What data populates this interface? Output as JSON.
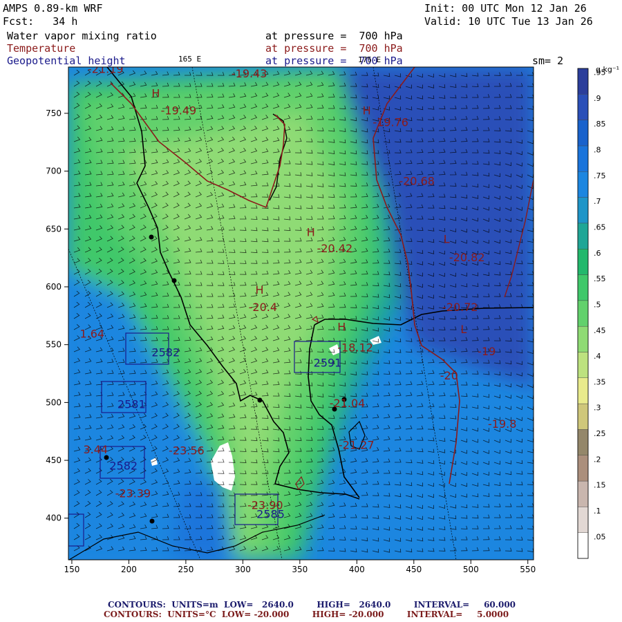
{
  "header": {
    "model": "AMPS 0.89-km WRF",
    "forecast": "Fcst:   34 h",
    "init": "Init: 00 UTC Mon 12 Jan 26",
    "valid": "Valid: 10 UTC Tue 13 Jan 26",
    "field1_name": "Water vapor mixing ratio",
    "field1_level": "at pressure =  700 hPa",
    "field2_name": "Temperature",
    "field2_level": "at pressure =  700 hPa",
    "field3_name": "Geopotential height",
    "field3_level": "at pressure =  700 hPa",
    "smoothing": "sm= 2",
    "lon_label_left": "165 E",
    "lon_label_right": "175 E"
  },
  "colorbar": {
    "unit": "g kg⁻¹",
    "levels": [
      ".05",
      ".1",
      ".15",
      ".2",
      ".25",
      ".3",
      ".35",
      ".4",
      ".45",
      ".5",
      ".55",
      ".6",
      ".65",
      ".7",
      ".75",
      ".8",
      ".85",
      ".9",
      ".95"
    ],
    "colors": [
      "#ffffff",
      "#e2d8d4",
      "#c9b6ae",
      "#ab8f7c",
      "#94876a",
      "#cfc77a",
      "#e9eb8c",
      "#bde27f",
      "#8fdb74",
      "#62d16c",
      "#3fc86a",
      "#22b86c",
      "#1fa696",
      "#1e95c8",
      "#1c86e0",
      "#1a74db",
      "#1962cc",
      "#2a4fb8",
      "#2b3e9b"
    ]
  },
  "chart_data": {
    "type": "heatmap",
    "title": "Water vapor mixing ratio at pressure = 700 hPa",
    "x_ticks": [
      "150",
      "200",
      "250",
      "300",
      "350",
      "400",
      "450",
      "500",
      "550"
    ],
    "y_ticks": [
      "400",
      "450",
      "500",
      "550",
      "600",
      "650",
      "700",
      "750"
    ],
    "xlim": [
      147,
      555
    ],
    "ylim": [
      364,
      790
    ],
    "temperature_labels": [
      {
        "text": "H",
        "x": 220,
        "y": 764
      },
      {
        "text": "-19.49",
        "x": 228,
        "y": 749
      },
      {
        "text": "-19.43",
        "x": 290,
        "y": 781
      },
      {
        "text": "H",
        "x": 405,
        "y": 749
      },
      {
        "text": "-19.76",
        "x": 414,
        "y": 739
      },
      {
        "text": "-20.68",
        "x": 437,
        "y": 688
      },
      {
        "text": "H",
        "x": 356,
        "y": 644
      },
      {
        "text": "-20.42",
        "x": 365,
        "y": 630
      },
      {
        "text": "L",
        "x": 476,
        "y": 638
      },
      {
        "text": "-20.82",
        "x": 481,
        "y": 622
      },
      {
        "text": "H",
        "x": 311,
        "y": 594
      },
      {
        "text": "-20.4",
        "x": 305,
        "y": 579
      },
      {
        "text": "-20.72",
        "x": 475,
        "y": 579
      },
      {
        "text": "H",
        "x": 383,
        "y": 562
      },
      {
        "text": "-18.12",
        "x": 383,
        "y": 544
      },
      {
        "text": "L",
        "x": 491,
        "y": 560
      },
      {
        "text": "-19",
        "x": 506,
        "y": 541
      },
      {
        "text": "-20",
        "x": 473,
        "y": 520
      },
      {
        "text": "-23.56",
        "x": 235,
        "y": 455
      },
      {
        "text": "-23.39",
        "x": 188,
        "y": 418
      },
      {
        "text": "-21.27",
        "x": 384,
        "y": 460
      },
      {
        "text": "-21.04",
        "x": 376,
        "y": 496
      },
      {
        "text": "-19.8",
        "x": 515,
        "y": 478
      },
      {
        "text": "-23.90",
        "x": 304,
        "y": 408
      },
      {
        "text": "1.64",
        "x": 157,
        "y": 556
      },
      {
        "text": "3.44",
        "x": 160,
        "y": 456
      },
      {
        "text": "-21.19",
        "x": 164,
        "y": 785
      }
    ],
    "height_labels": [
      {
        "text": "2582",
        "x": 220,
        "y": 540
      },
      {
        "text": "2581",
        "x": 190,
        "y": 495
      },
      {
        "text": "2582",
        "x": 183,
        "y": 442
      },
      {
        "text": "2585",
        "x": 312,
        "y": 400
      },
      {
        "text": "2591",
        "x": 362,
        "y": 531
      }
    ],
    "series": [
      {
        "name": "Geopotential height",
        "contour": "2640.0"
      },
      {
        "name": "Temperature",
        "contour": "-20.000"
      }
    ]
  },
  "footer": {
    "line1_prefix": "CONTOURS:",
    "line1_units": "UNITS=m",
    "line1_low": "LOW=   2640.0",
    "line1_high": "HIGH=   2640.0",
    "line1_interval": "INTERVAL=     60.000",
    "line2_prefix": "CONTOURS:",
    "line2_units": "UNITS=°C",
    "line2_low": "LOW= -20.000",
    "line2_high": "HIGH= -20.000",
    "line2_interval": "INTERVAL=     5.0000"
  }
}
